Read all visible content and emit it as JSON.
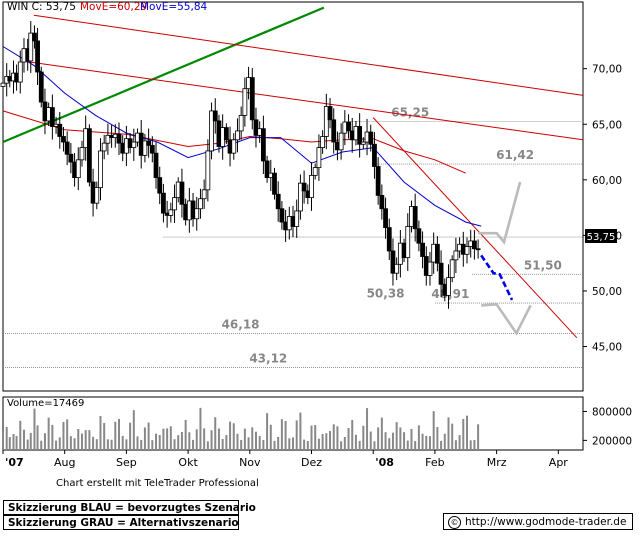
{
  "chart_data": {
    "type": "candlestick",
    "header": {
      "symbol_text": "WIN C: 53,75",
      "ma1_text": "MovE=60,29",
      "ma2_text": "MovE=55,84",
      "ma1_color": "#cc0000",
      "ma2_color": "#0000cc"
    },
    "price_axis": {
      "ylim": [
        41,
        76
      ],
      "ticks": [
        {
          "value": 45,
          "label": "45,00"
        },
        {
          "value": 50,
          "label": "50,00"
        },
        {
          "value": 55,
          "label": "55,00"
        },
        {
          "value": 60,
          "label": "60,00"
        },
        {
          "value": 65,
          "label": "65,00"
        },
        {
          "value": 70,
          "label": "70,00"
        }
      ],
      "last_price_label": "53,75",
      "last_price": 53.75
    },
    "time_axis": {
      "xlim": [
        0,
        9.4
      ],
      "ticks": [
        {
          "pos": 0.0,
          "label": "'07"
        },
        {
          "pos": 1.0,
          "label": "Aug"
        },
        {
          "pos": 2.0,
          "label": "Sep"
        },
        {
          "pos": 3.0,
          "label": "Okt"
        },
        {
          "pos": 4.0,
          "label": "Nov"
        },
        {
          "pos": 5.0,
          "label": "Dez"
        },
        {
          "pos": 6.0,
          "label": "'08"
        },
        {
          "pos": 7.0,
          "label": "Feb"
        },
        {
          "pos": 8.0,
          "label": "Mrz"
        },
        {
          "pos": 9.0,
          "label": "Apr"
        }
      ]
    },
    "levels": [
      {
        "value": 65.25,
        "label": "65,25",
        "x_start": 5.6,
        "label_pos": 6.6
      },
      {
        "value": 61.42,
        "label": "61,42",
        "x_start": 6.0,
        "label_pos": 8.3
      },
      {
        "value": 54.85,
        "label": "",
        "x_start": 2.6,
        "label_pos": null
      },
      {
        "value": 51.5,
        "label": "51,50",
        "x_start": 7.6,
        "label_pos": 8.75
      },
      {
        "value": 48.91,
        "label": "48,91",
        "x_start": 7.0,
        "label_pos": 7.25
      },
      {
        "value": 46.18,
        "label": "46,18",
        "x_start": 0.0,
        "label_pos": 3.85
      },
      {
        "value": 43.12,
        "label": "43,12",
        "x_start": 0.0,
        "label_pos": 4.3
      }
    ],
    "extra_labels": [
      {
        "value": 50.38,
        "label": "50,38",
        "pos": 6.2
      }
    ],
    "trendlines": [
      {
        "name": "green-uptrend",
        "color": "#008800",
        "width": 2.2,
        "points": [
          [
            0.0,
            63.4
          ],
          [
            5.2,
            75.5
          ]
        ]
      },
      {
        "name": "red-downtrend-upper",
        "color": "#cc0000",
        "width": 1,
        "points": [
          [
            0.5,
            74.8
          ],
          [
            9.4,
            67.6
          ]
        ]
      },
      {
        "name": "red-downtrend-lower",
        "color": "#cc0000",
        "width": 1,
        "points": [
          [
            0.3,
            70.7
          ],
          [
            9.4,
            63.6
          ]
        ]
      },
      {
        "name": "red-steep-downtrend",
        "color": "#cc0000",
        "width": 1,
        "points": [
          [
            6.0,
            65.6
          ],
          [
            9.3,
            45.8
          ]
        ]
      }
    ],
    "moving_averages": [
      {
        "name": "ma-red",
        "color": "#cc0000",
        "points": [
          [
            0.0,
            66.2
          ],
          [
            1.0,
            64.5
          ],
          [
            2.0,
            64.1
          ],
          [
            3.0,
            63.0
          ],
          [
            3.5,
            63.3
          ],
          [
            4.0,
            63.9
          ],
          [
            4.5,
            63.7
          ],
          [
            5.0,
            63.4
          ],
          [
            5.5,
            63.6
          ],
          [
            6.0,
            63.7
          ],
          [
            6.5,
            62.6
          ],
          [
            7.0,
            61.8
          ],
          [
            7.5,
            60.6
          ]
        ]
      },
      {
        "name": "ma-blue",
        "color": "#0000cc",
        "points": [
          [
            0.0,
            72.0
          ],
          [
            0.5,
            70.3
          ],
          [
            1.0,
            67.8
          ],
          [
            1.5,
            65.8
          ],
          [
            2.0,
            64.2
          ],
          [
            2.5,
            63.4
          ],
          [
            3.0,
            62.0
          ],
          [
            3.5,
            62.8
          ],
          [
            4.0,
            63.8
          ],
          [
            4.5,
            63.8
          ],
          [
            5.0,
            61.5
          ],
          [
            5.5,
            62.5
          ],
          [
            6.0,
            62.9
          ],
          [
            6.5,
            59.8
          ],
          [
            7.0,
            57.7
          ],
          [
            7.5,
            56.2
          ],
          [
            7.75,
            55.84
          ]
        ]
      }
    ],
    "scenario_arrows": [
      {
        "name": "blue-preferred",
        "color": "#0000ee",
        "dashed": true,
        "points": [
          [
            7.75,
            53.2
          ],
          [
            7.95,
            51.6
          ],
          [
            8.05,
            51.5
          ],
          [
            8.25,
            49.2
          ]
        ]
      },
      {
        "name": "grey-alt-up",
        "color": "#bbbbbb",
        "dashed": false,
        "points": [
          [
            7.7,
            55.2
          ],
          [
            8.0,
            55.2
          ],
          [
            8.12,
            54.4
          ],
          [
            8.38,
            59.8
          ]
        ]
      },
      {
        "name": "grey-alt-down",
        "color": "#bbbbbb",
        "dashed": false,
        "points": [
          [
            7.75,
            48.7
          ],
          [
            8.0,
            48.8
          ],
          [
            8.32,
            46.2
          ],
          [
            8.55,
            48.7
          ]
        ]
      }
    ],
    "price_path": [
      [
        0.0,
        68.7
      ],
      [
        0.06,
        69.3
      ],
      [
        0.11,
        68.9
      ],
      [
        0.17,
        69.6
      ],
      [
        0.22,
        68.8
      ],
      [
        0.28,
        70.6
      ],
      [
        0.34,
        71.8
      ],
      [
        0.4,
        70.7
      ],
      [
        0.45,
        73.2
      ],
      [
        0.51,
        72.5
      ],
      [
        0.56,
        69.7
      ],
      [
        0.62,
        67.0
      ],
      [
        0.68,
        65.3
      ],
      [
        0.74,
        66.5
      ],
      [
        0.8,
        64.8
      ],
      [
        0.86,
        65.0
      ],
      [
        0.92,
        63.9
      ],
      [
        0.98,
        63.4
      ],
      [
        1.04,
        62.3
      ],
      [
        1.1,
        61.6
      ],
      [
        1.16,
        60.2
      ],
      [
        1.22,
        61.8
      ],
      [
        1.28,
        62.9
      ],
      [
        1.34,
        64.6
      ],
      [
        1.4,
        59.8
      ],
      [
        1.46,
        57.9
      ],
      [
        1.52,
        59.3
      ],
      [
        1.58,
        62.6
      ],
      [
        1.64,
        63.3
      ],
      [
        1.7,
        64.0
      ],
      [
        1.76,
        63.8
      ],
      [
        1.82,
        64.1
      ],
      [
        1.88,
        63.3
      ],
      [
        1.94,
        62.4
      ],
      [
        2.0,
        63.7
      ],
      [
        2.06,
        62.9
      ],
      [
        2.12,
        63.4
      ],
      [
        2.18,
        64.2
      ],
      [
        2.24,
        62.2
      ],
      [
        2.3,
        63.5
      ],
      [
        2.36,
        63.1
      ],
      [
        2.42,
        62.4
      ],
      [
        2.48,
        60.2
      ],
      [
        2.54,
        58.8
      ],
      [
        2.6,
        57.0
      ],
      [
        2.66,
        56.8
      ],
      [
        2.72,
        57.3
      ],
      [
        2.78,
        58.4
      ],
      [
        2.84,
        59.8
      ],
      [
        2.9,
        57.8
      ],
      [
        2.96,
        56.4
      ],
      [
        3.02,
        58.1
      ],
      [
        3.08,
        56.5
      ],
      [
        3.14,
        57.4
      ],
      [
        3.2,
        58.3
      ],
      [
        3.26,
        59.1
      ],
      [
        3.32,
        62.6
      ],
      [
        3.38,
        66.2
      ],
      [
        3.44,
        65.3
      ],
      [
        3.5,
        63.0
      ],
      [
        3.56,
        64.7
      ],
      [
        3.62,
        63.6
      ],
      [
        3.68,
        62.4
      ],
      [
        3.74,
        63.6
      ],
      [
        3.8,
        64.4
      ],
      [
        3.86,
        65.8
      ],
      [
        3.92,
        68.2
      ],
      [
        3.98,
        69.2
      ],
      [
        4.04,
        65.4
      ],
      [
        4.1,
        64.0
      ],
      [
        4.16,
        64.6
      ],
      [
        4.22,
        61.7
      ],
      [
        4.28,
        60.2
      ],
      [
        4.34,
        60.6
      ],
      [
        4.4,
        58.7
      ],
      [
        4.46,
        57.4
      ],
      [
        4.52,
        56.2
      ],
      [
        4.58,
        55.5
      ],
      [
        4.64,
        56.7
      ],
      [
        4.7,
        55.8
      ],
      [
        4.76,
        57.2
      ],
      [
        4.82,
        59.7
      ],
      [
        4.88,
        59.0
      ],
      [
        4.94,
        58.4
      ],
      [
        5.0,
        60.4
      ],
      [
        5.06,
        61.1
      ],
      [
        5.12,
        62.9
      ],
      [
        5.18,
        63.9
      ],
      [
        5.24,
        66.6
      ],
      [
        5.3,
        65.4
      ],
      [
        5.36,
        63.4
      ],
      [
        5.42,
        62.7
      ],
      [
        5.48,
        64.2
      ],
      [
        5.54,
        65.2
      ],
      [
        5.6,
        64.4
      ],
      [
        5.66,
        63.6
      ],
      [
        5.72,
        64.8
      ],
      [
        5.78,
        63.2
      ],
      [
        5.84,
        63.4
      ],
      [
        5.9,
        64.3
      ],
      [
        5.96,
        63.2
      ],
      [
        6.02,
        61.2
      ],
      [
        6.08,
        58.6
      ],
      [
        6.14,
        57.4
      ],
      [
        6.2,
        55.7
      ],
      [
        6.26,
        53.6
      ],
      [
        6.32,
        51.6
      ],
      [
        6.38,
        52.4
      ],
      [
        6.44,
        54.3
      ],
      [
        6.5,
        53.0
      ],
      [
        6.56,
        55.8
      ],
      [
        6.62,
        57.6
      ],
      [
        6.68,
        55.6
      ],
      [
        6.74,
        54.3
      ],
      [
        6.8,
        53.1
      ],
      [
        6.86,
        51.4
      ],
      [
        6.92,
        52.6
      ],
      [
        6.98,
        54.2
      ],
      [
        7.04,
        52.5
      ],
      [
        7.1,
        50.6
      ],
      [
        7.16,
        49.6
      ],
      [
        7.22,
        51.2
      ],
      [
        7.28,
        52.8
      ],
      [
        7.34,
        53.6
      ],
      [
        7.4,
        54.2
      ],
      [
        7.46,
        53.3
      ],
      [
        7.52,
        54.0
      ],
      [
        7.58,
        54.5
      ],
      [
        7.64,
        53.8
      ],
      [
        7.7,
        53.75
      ]
    ],
    "volume": {
      "label": "Volume=17469",
      "ylim": [
        0,
        1100000
      ],
      "ticks": [
        {
          "value": 200000,
          "label": "200000"
        },
        {
          "value": 800000,
          "label": "800000"
        }
      ]
    }
  },
  "notes": {
    "credit": "Chart erstellt mit TeleTrader Professional",
    "legend_blue": "Skizzierung BLAU = bevorzugtes Szenario",
    "legend_grey": "Skizzierung GRAU = Alternativszenario",
    "url": "http://www.godmode-trader.de",
    "url_icon": "copyright-icon"
  }
}
